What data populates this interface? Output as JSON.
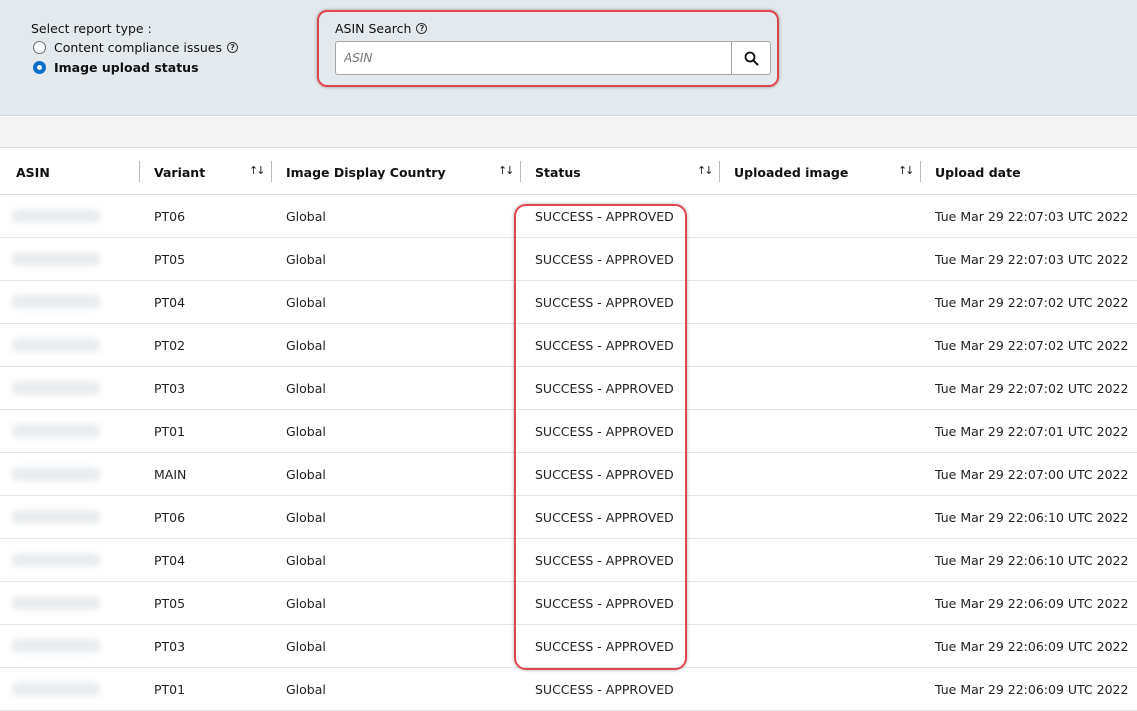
{
  "filters": {
    "report_type_label": "Select report type :",
    "options": [
      {
        "label": "Content compliance issues",
        "selected": false,
        "has_help": true
      },
      {
        "label": "Image upload status",
        "selected": true,
        "has_help": false
      }
    ],
    "search_label": "ASIN Search",
    "search_placeholder": "ASIN",
    "search_icon": "search-icon",
    "help_icon_glyph": "?"
  },
  "table": {
    "columns": [
      "ASIN",
      "Variant",
      "Image Display Country",
      "Status",
      "Uploaded image",
      "Upload date"
    ],
    "sort_glyph": "↑↓",
    "rows": [
      {
        "variant": "PT06",
        "country": "Global",
        "status": "SUCCESS - APPROVED",
        "date": "Tue Mar 29 22:07:03 UTC 2022"
      },
      {
        "variant": "PT05",
        "country": "Global",
        "status": "SUCCESS - APPROVED",
        "date": "Tue Mar 29 22:07:03 UTC 2022"
      },
      {
        "variant": "PT04",
        "country": "Global",
        "status": "SUCCESS - APPROVED",
        "date": "Tue Mar 29 22:07:02 UTC 2022"
      },
      {
        "variant": "PT02",
        "country": "Global",
        "status": "SUCCESS - APPROVED",
        "date": "Tue Mar 29 22:07:02 UTC 2022"
      },
      {
        "variant": "PT03",
        "country": "Global",
        "status": "SUCCESS - APPROVED",
        "date": "Tue Mar 29 22:07:02 UTC 2022"
      },
      {
        "variant": "PT01",
        "country": "Global",
        "status": "SUCCESS - APPROVED",
        "date": "Tue Mar 29 22:07:01 UTC 2022"
      },
      {
        "variant": "MAIN",
        "country": "Global",
        "status": "SUCCESS - APPROVED",
        "date": "Tue Mar 29 22:07:00 UTC 2022"
      },
      {
        "variant": "PT06",
        "country": "Global",
        "status": "SUCCESS - APPROVED",
        "date": "Tue Mar 29 22:06:10 UTC 2022"
      },
      {
        "variant": "PT04",
        "country": "Global",
        "status": "SUCCESS - APPROVED",
        "date": "Tue Mar 29 22:06:10 UTC 2022"
      },
      {
        "variant": "PT05",
        "country": "Global",
        "status": "SUCCESS - APPROVED",
        "date": "Tue Mar 29 22:06:09 UTC 2022"
      },
      {
        "variant": "PT03",
        "country": "Global",
        "status": "SUCCESS - APPROVED",
        "date": "Tue Mar 29 22:06:09 UTC 2022"
      },
      {
        "variant": "PT01",
        "country": "Global",
        "status": "SUCCESS - APPROVED",
        "date": "Tue Mar 29 22:06:09 UTC 2022"
      }
    ]
  },
  "colors": {
    "highlight": "#e0464d",
    "panel_bg": "#e3e9ec",
    "radio_selected": "#0a6ecb"
  }
}
